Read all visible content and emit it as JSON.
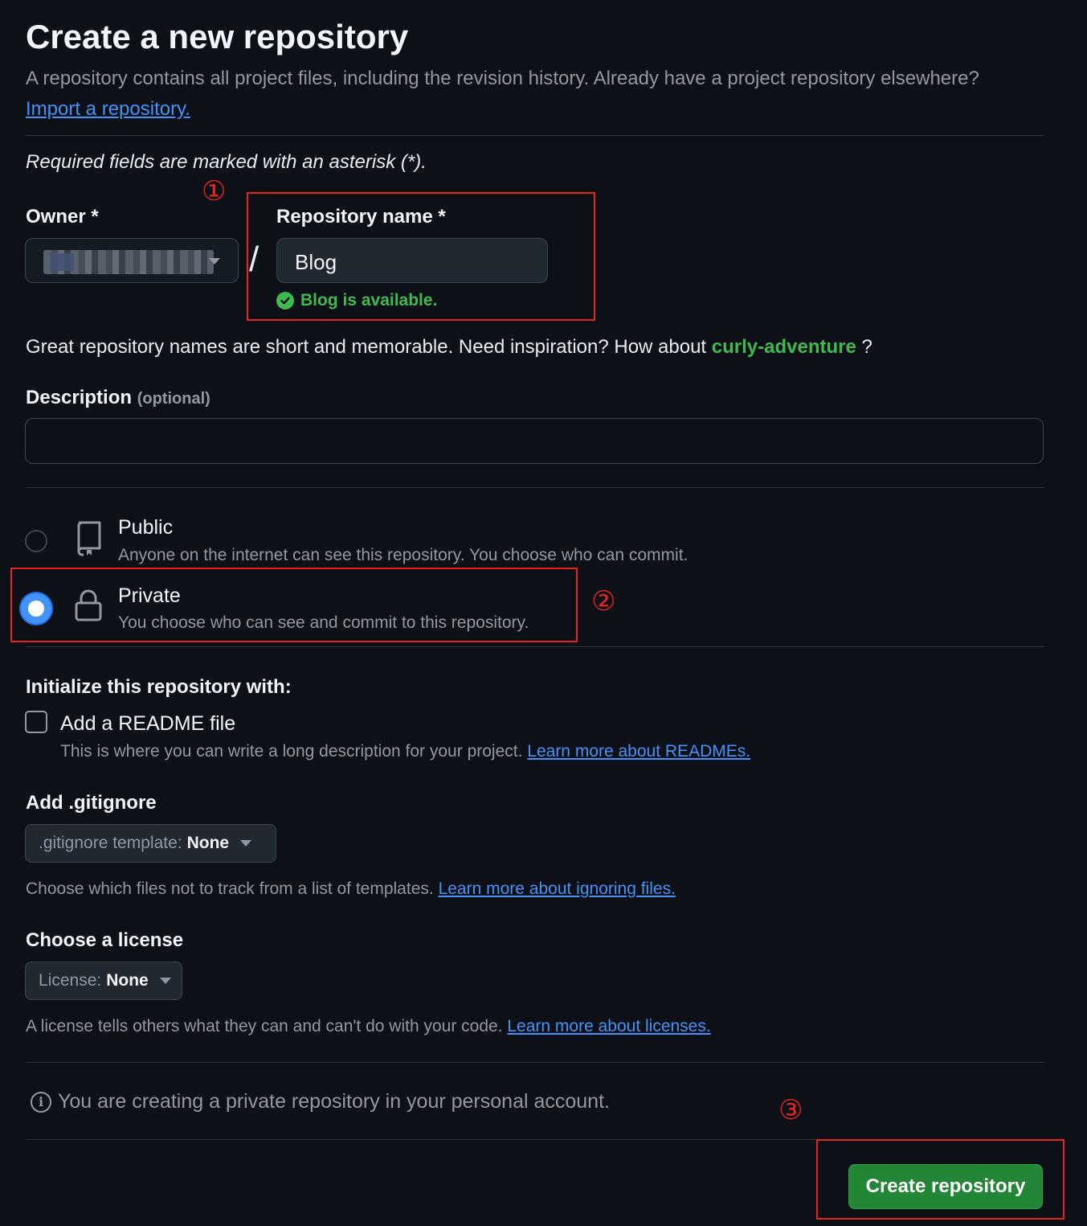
{
  "header": {
    "title": "Create a new repository",
    "subtitle": "A repository contains all project files, including the revision history. Already have a project repository elsewhere?",
    "import_link": "Import a repository."
  },
  "form": {
    "required_note": "Required fields are marked with an asterisk (*).",
    "owner": {
      "label": "Owner *"
    },
    "separator": "/",
    "repo_name": {
      "label": "Repository name *",
      "value": "Blog",
      "status": "Blog is available."
    },
    "name_hint": {
      "text": "Great repository names are short and memorable. Need inspiration? How about",
      "suggestion": "curly-adventure",
      "suffix": " ?"
    },
    "description": {
      "label": "Description",
      "optional": "(optional)",
      "value": ""
    },
    "visibility": {
      "selected": "Private",
      "options": [
        {
          "title": "Public",
          "desc": "Anyone on the internet can see this repository. You choose who can commit.",
          "icon": "repo-icon",
          "checked": false
        },
        {
          "title": "Private",
          "desc": "You choose who can see and commit to this repository.",
          "icon": "lock-icon",
          "checked": true
        }
      ]
    },
    "initialize": {
      "heading": "Initialize this repository with:",
      "readme": {
        "label": "Add a README file",
        "checked": false,
        "desc": "This is where you can write a long description for your project.",
        "link": "Learn more about READMEs."
      }
    },
    "gitignore": {
      "heading": "Add .gitignore",
      "select_prefix": ".gitignore template:",
      "select_value": "None",
      "help": "Choose which files not to track from a list of templates.",
      "link": "Learn more about ignoring files."
    },
    "license": {
      "heading": "Choose a license",
      "select_prefix": "License:",
      "select_value": "None",
      "help": "A license tells others what they can and can't do with your code.",
      "link": "Learn more about licenses."
    },
    "info": "You are creating a private repository in your personal account.",
    "submit_label": "Create repository"
  },
  "annotations": {
    "step1": "①",
    "step2": "②",
    "step3": "③",
    "color": "#e5261f"
  },
  "colors": {
    "background": "#0d1117",
    "accent_link": "#4493f8",
    "success": "#3fb950",
    "primary_button": "#238636"
  }
}
